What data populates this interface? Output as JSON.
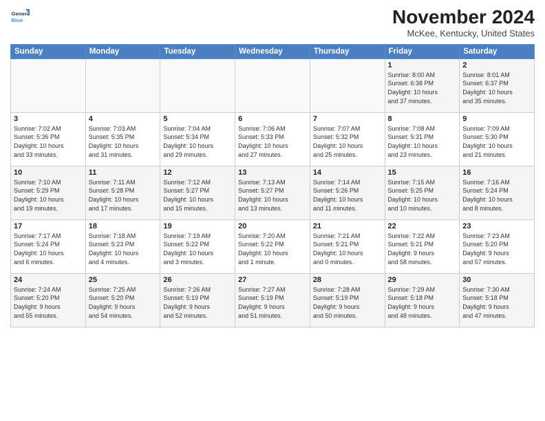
{
  "header": {
    "logo_line1": "General",
    "logo_line2": "Blue",
    "month": "November 2024",
    "location": "McKee, Kentucky, United States"
  },
  "weekdays": [
    "Sunday",
    "Monday",
    "Tuesday",
    "Wednesday",
    "Thursday",
    "Friday",
    "Saturday"
  ],
  "weeks": [
    [
      {
        "day": "",
        "info": ""
      },
      {
        "day": "",
        "info": ""
      },
      {
        "day": "",
        "info": ""
      },
      {
        "day": "",
        "info": ""
      },
      {
        "day": "",
        "info": ""
      },
      {
        "day": "1",
        "info": "Sunrise: 8:00 AM\nSunset: 6:38 PM\nDaylight: 10 hours\nand 37 minutes."
      },
      {
        "day": "2",
        "info": "Sunrise: 8:01 AM\nSunset: 6:37 PM\nDaylight: 10 hours\nand 35 minutes."
      }
    ],
    [
      {
        "day": "3",
        "info": "Sunrise: 7:02 AM\nSunset: 5:36 PM\nDaylight: 10 hours\nand 33 minutes."
      },
      {
        "day": "4",
        "info": "Sunrise: 7:03 AM\nSunset: 5:35 PM\nDaylight: 10 hours\nand 31 minutes."
      },
      {
        "day": "5",
        "info": "Sunrise: 7:04 AM\nSunset: 5:34 PM\nDaylight: 10 hours\nand 29 minutes."
      },
      {
        "day": "6",
        "info": "Sunrise: 7:06 AM\nSunset: 5:33 PM\nDaylight: 10 hours\nand 27 minutes."
      },
      {
        "day": "7",
        "info": "Sunrise: 7:07 AM\nSunset: 5:32 PM\nDaylight: 10 hours\nand 25 minutes."
      },
      {
        "day": "8",
        "info": "Sunrise: 7:08 AM\nSunset: 5:31 PM\nDaylight: 10 hours\nand 23 minutes."
      },
      {
        "day": "9",
        "info": "Sunrise: 7:09 AM\nSunset: 5:30 PM\nDaylight: 10 hours\nand 21 minutes."
      }
    ],
    [
      {
        "day": "10",
        "info": "Sunrise: 7:10 AM\nSunset: 5:29 PM\nDaylight: 10 hours\nand 19 minutes."
      },
      {
        "day": "11",
        "info": "Sunrise: 7:11 AM\nSunset: 5:28 PM\nDaylight: 10 hours\nand 17 minutes."
      },
      {
        "day": "12",
        "info": "Sunrise: 7:12 AM\nSunset: 5:27 PM\nDaylight: 10 hours\nand 15 minutes."
      },
      {
        "day": "13",
        "info": "Sunrise: 7:13 AM\nSunset: 5:27 PM\nDaylight: 10 hours\nand 13 minutes."
      },
      {
        "day": "14",
        "info": "Sunrise: 7:14 AM\nSunset: 5:26 PM\nDaylight: 10 hours\nand 11 minutes."
      },
      {
        "day": "15",
        "info": "Sunrise: 7:15 AM\nSunset: 5:25 PM\nDaylight: 10 hours\nand 10 minutes."
      },
      {
        "day": "16",
        "info": "Sunrise: 7:16 AM\nSunset: 5:24 PM\nDaylight: 10 hours\nand 8 minutes."
      }
    ],
    [
      {
        "day": "17",
        "info": "Sunrise: 7:17 AM\nSunset: 5:24 PM\nDaylight: 10 hours\nand 6 minutes."
      },
      {
        "day": "18",
        "info": "Sunrise: 7:18 AM\nSunset: 5:23 PM\nDaylight: 10 hours\nand 4 minutes."
      },
      {
        "day": "19",
        "info": "Sunrise: 7:19 AM\nSunset: 5:22 PM\nDaylight: 10 hours\nand 3 minutes."
      },
      {
        "day": "20",
        "info": "Sunrise: 7:20 AM\nSunset: 5:22 PM\nDaylight: 10 hours\nand 1 minute."
      },
      {
        "day": "21",
        "info": "Sunrise: 7:21 AM\nSunset: 5:21 PM\nDaylight: 10 hours\nand 0 minutes."
      },
      {
        "day": "22",
        "info": "Sunrise: 7:22 AM\nSunset: 5:21 PM\nDaylight: 9 hours\nand 58 minutes."
      },
      {
        "day": "23",
        "info": "Sunrise: 7:23 AM\nSunset: 5:20 PM\nDaylight: 9 hours\nand 57 minutes."
      }
    ],
    [
      {
        "day": "24",
        "info": "Sunrise: 7:24 AM\nSunset: 5:20 PM\nDaylight: 9 hours\nand 55 minutes."
      },
      {
        "day": "25",
        "info": "Sunrise: 7:25 AM\nSunset: 5:20 PM\nDaylight: 9 hours\nand 54 minutes."
      },
      {
        "day": "26",
        "info": "Sunrise: 7:26 AM\nSunset: 5:19 PM\nDaylight: 9 hours\nand 52 minutes."
      },
      {
        "day": "27",
        "info": "Sunrise: 7:27 AM\nSunset: 5:19 PM\nDaylight: 9 hours\nand 51 minutes."
      },
      {
        "day": "28",
        "info": "Sunrise: 7:28 AM\nSunset: 5:19 PM\nDaylight: 9 hours\nand 50 minutes."
      },
      {
        "day": "29",
        "info": "Sunrise: 7:29 AM\nSunset: 5:18 PM\nDaylight: 9 hours\nand 48 minutes."
      },
      {
        "day": "30",
        "info": "Sunrise: 7:30 AM\nSunset: 5:18 PM\nDaylight: 9 hours\nand 47 minutes."
      }
    ]
  ]
}
